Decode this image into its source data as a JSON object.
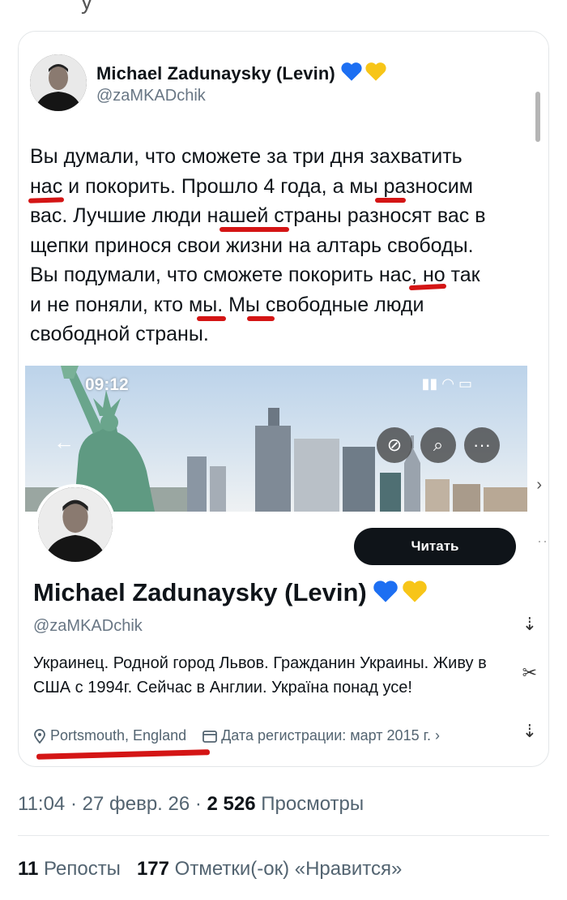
{
  "tweet": {
    "author_name": "Michael Zadunaysky (Levin)",
    "author_handle": "@zaMKADchik",
    "text": "Вы думали, что сможете за три дня захватить\nнас и покорить. Прошло 4 года, а мы разносим\nвас. Лучшие люди нашей страны разносят вас в\nщепки принося свои жизни на алтарь свободы.\nВы подумали, что сможете покорить нас, но так\nи не поняли, кто мы. Мы свободные люди\nсвободной страны."
  },
  "screenshot": {
    "status_time": "09:12",
    "follow_button": "Читать",
    "profile_name": "Michael Zadunaysky (Levin)",
    "profile_handle": "@zaMKADchik",
    "bio": "Украинец. Родной город Львов. Гражданин Украины. Живу в США с 1994г. Сейчас в Англии. Україна понад усе!",
    "location": "Portsmouth, England",
    "joined": "Дата регистрации: март 2015 г."
  },
  "footer": {
    "time_date": "11:04 · 27 февр. 26 · ",
    "views_count": "2 526",
    "views_label": " Просмотры",
    "reposts_count": "11",
    "reposts_label": " Репосты",
    "likes_count": "177",
    "likes_label": " Отметки(-ок) «Нравится»"
  },
  "colors": {
    "underline": "#d41515",
    "heart_blue": "#1d6ff2",
    "heart_yellow": "#f7c518",
    "button": "#0f1419"
  },
  "icons": [
    "blue-heart-icon",
    "yellow-heart-icon",
    "back-arrow-icon",
    "slash-circle-icon",
    "search-icon",
    "more-icon",
    "location-icon",
    "calendar-icon",
    "share-icon"
  ]
}
